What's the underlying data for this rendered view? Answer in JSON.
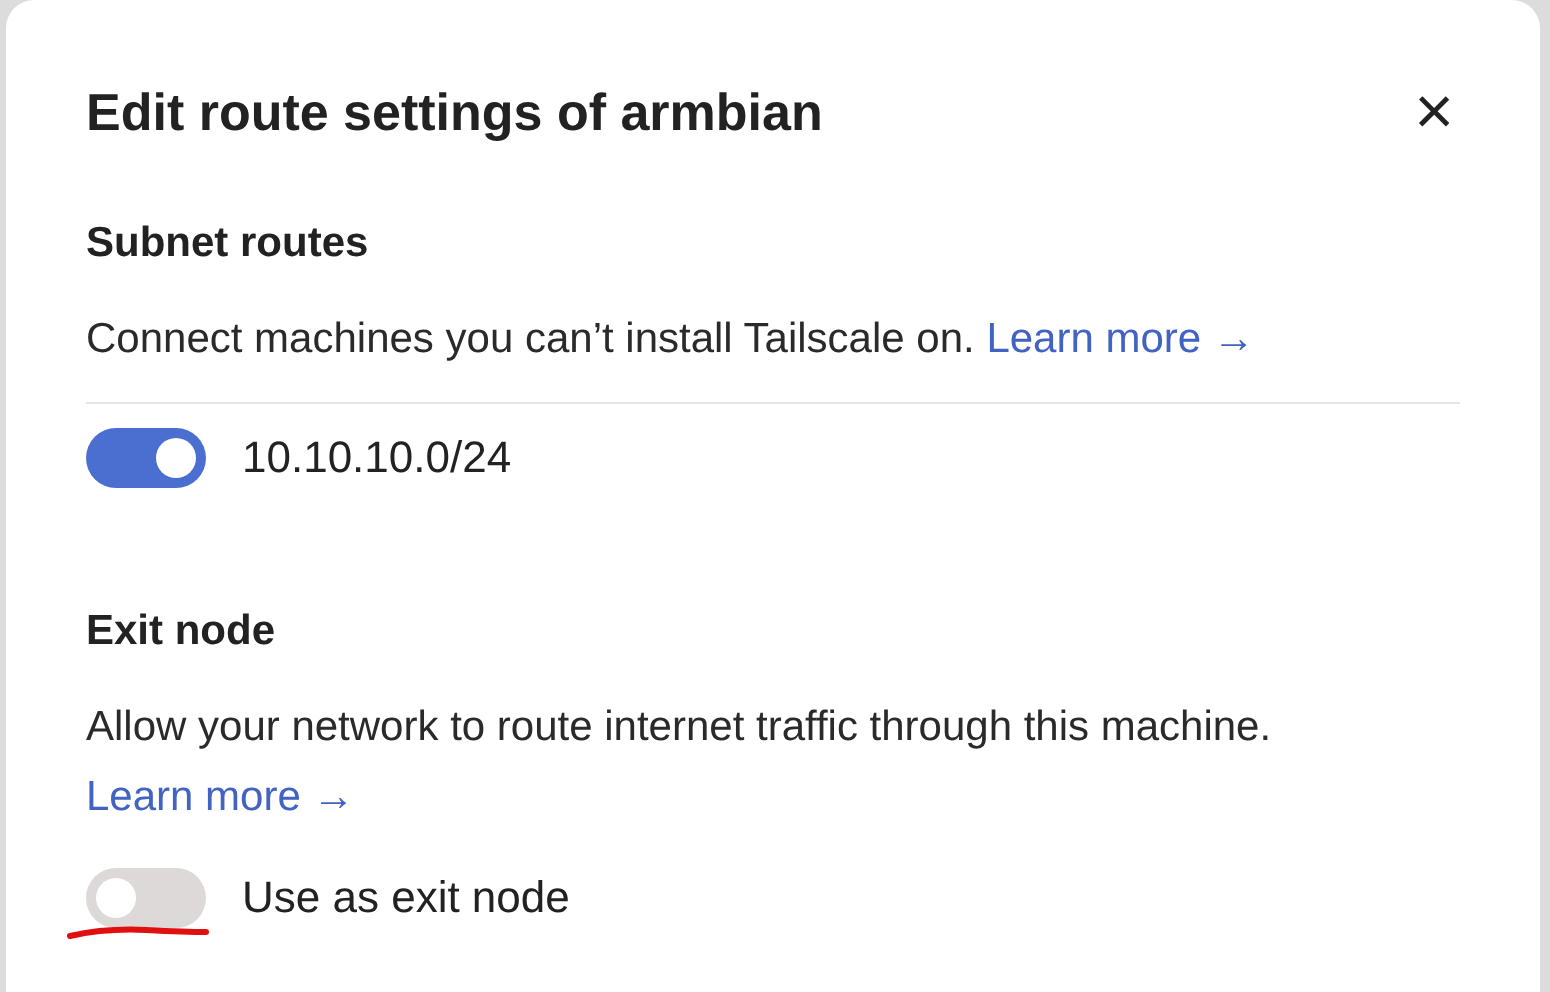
{
  "dialog": {
    "title": "Edit route settings of armbian",
    "close_label": "×"
  },
  "sections": [
    {
      "heading": "Subnet routes",
      "description": "Connect machines you can’t install Tailscale on.",
      "link": "Learn more →",
      "divider": true,
      "toggles": [
        {
          "label": "10.10.10.0/24",
          "on": true
        }
      ]
    },
    {
      "heading": "Exit node",
      "description": "Allow your network to route internet traffic through this machine.",
      "link": "Learn more →",
      "divider": false,
      "toggles": [
        {
          "label": "Use as exit node",
          "on": false
        }
      ]
    }
  ]
}
